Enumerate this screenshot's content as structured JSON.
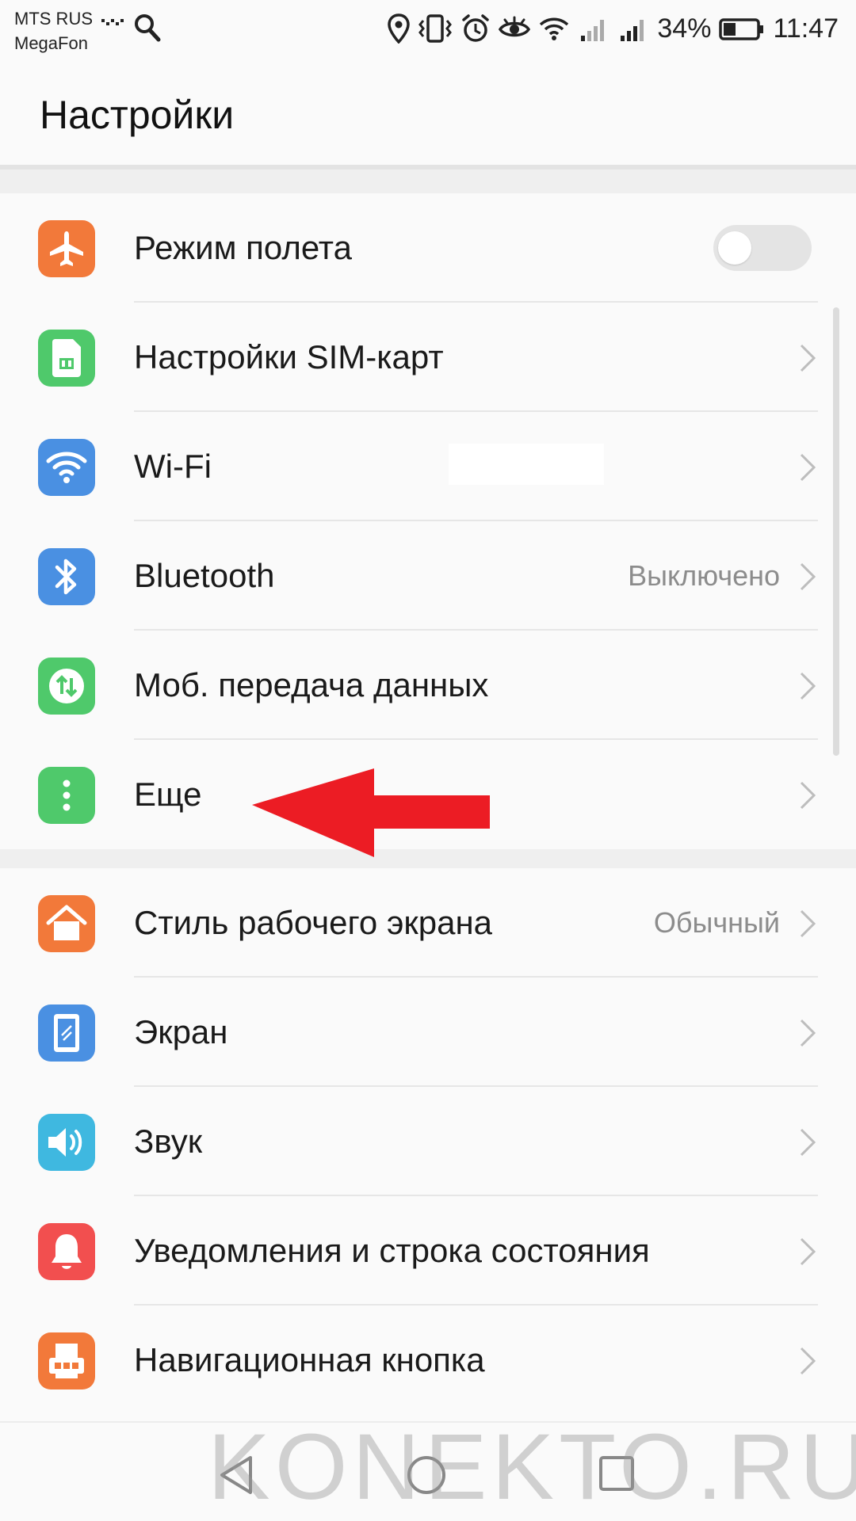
{
  "status_bar": {
    "carrier_1": "MTS RUS",
    "carrier_2": "MegaFon",
    "battery": "34%",
    "time": "11:47"
  },
  "header": {
    "title": "Настройки"
  },
  "groups": [
    {
      "items": [
        {
          "label": "Режим полета",
          "icon": "airplane-icon",
          "color": "#f2793a",
          "control": "toggle",
          "toggle_on": false
        },
        {
          "label": "Настройки SIM-карт",
          "icon": "sim-card-icon",
          "color": "#4fc96b",
          "control": "chevron"
        },
        {
          "label": "Wi-Fi",
          "icon": "wifi-icon",
          "color": "#4a90e2",
          "control": "chevron"
        },
        {
          "label": "Bluetooth",
          "value": "Выключено",
          "icon": "bluetooth-icon",
          "color": "#4a90e2",
          "control": "chevron"
        },
        {
          "label": "Моб. передача данных",
          "icon": "mobile-data-icon",
          "color": "#4fc96b",
          "control": "chevron"
        },
        {
          "label": "Еще",
          "icon": "more-icon",
          "color": "#4fc96b",
          "control": "chevron"
        }
      ]
    },
    {
      "items": [
        {
          "label": "Стиль рабочего экрана",
          "value": "Обычный",
          "icon": "home-icon",
          "color": "#f2793a",
          "control": "chevron"
        },
        {
          "label": "Экран",
          "icon": "display-icon",
          "color": "#4a90e2",
          "control": "chevron"
        },
        {
          "label": "Звук",
          "icon": "sound-icon",
          "color": "#3fb8e0",
          "control": "chevron"
        },
        {
          "label": "Уведомления и строка состояния",
          "icon": "bell-icon",
          "color": "#f24f4f",
          "control": "chevron"
        },
        {
          "label": "Навигационная кнопка",
          "icon": "nav-key-icon",
          "color": "#f2793a",
          "control": "chevron"
        }
      ]
    }
  ],
  "annotation": {
    "arrow_color": "#ec1c24"
  },
  "watermark": "KONEKTO.RU"
}
